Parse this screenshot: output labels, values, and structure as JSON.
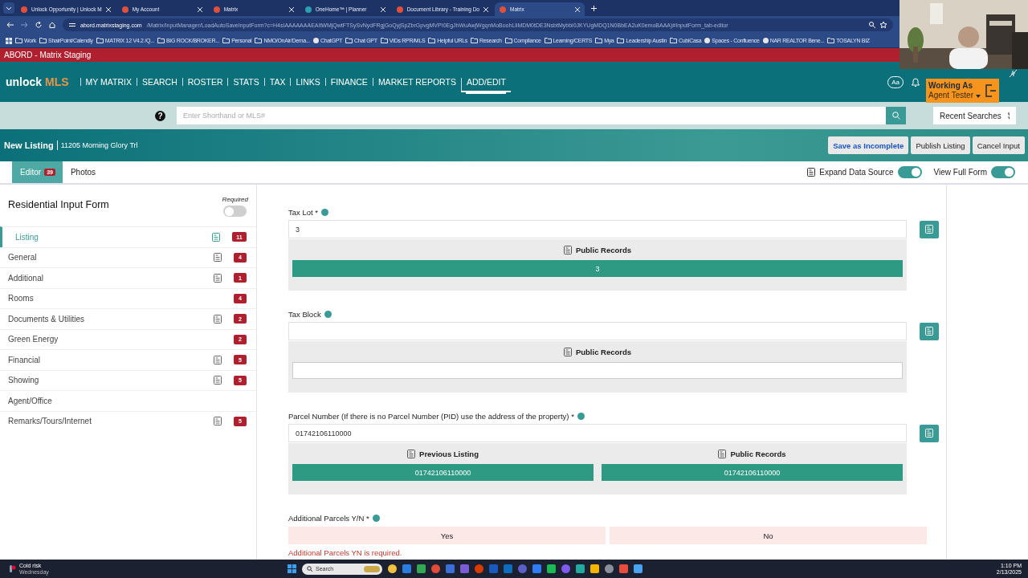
{
  "browser": {
    "tabs": [
      {
        "title": "Unlock Opportunity | Unlock M",
        "selected": false
      },
      {
        "title": "My Account",
        "selected": false
      },
      {
        "title": "Matrix",
        "selected": false
      },
      {
        "title": "OneHome™ | Planner",
        "selected": false
      },
      {
        "title": "Document Library - Training Do",
        "selected": false
      },
      {
        "title": "Matrix",
        "selected": true
      }
    ],
    "url": {
      "host": "abord.matrixstaging.com",
      "path": "/Matrix/InputManager/LoadAutoSaveInputForm?c=H4sIAAAAAAAEAItWMjQwtFTSySvNydFRgjGoQyjSpZbrGpvgMVPI0EgJhWuAwjWgqnMoBoohLliMDM0tDE3NsbtMybbi0JKYUgMDQ1N0BbEA2uK0emoBAAA)#InputForm_tab-editor"
    },
    "bookmarks": [
      {
        "label": "Work",
        "kind": "folder"
      },
      {
        "label": "ShairPoint/Calendly",
        "kind": "folder"
      },
      {
        "label": "MATRIX 12 V4.2 /Q...",
        "kind": "folder"
      },
      {
        "label": "BIG ROCK/BROKER...",
        "kind": "folder"
      },
      {
        "label": "Personal",
        "kind": "folder"
      },
      {
        "label": "NMO/OnAir/Dema...",
        "kind": "folder"
      },
      {
        "label": "ChatGPT",
        "kind": "site"
      },
      {
        "label": "Chat GPT",
        "kind": "folder"
      },
      {
        "label": "VIDs RPR/MLS",
        "kind": "folder"
      },
      {
        "label": "Helpful URLs",
        "kind": "folder"
      },
      {
        "label": "Research",
        "kind": "folder"
      },
      {
        "label": "Compliance",
        "kind": "folder"
      },
      {
        "label": "Learning/CERTS",
        "kind": "folder"
      },
      {
        "label": "Mya",
        "kind": "folder"
      },
      {
        "label": "Leadership Austin",
        "kind": "folder"
      },
      {
        "label": "CubiCasa",
        "kind": "folder"
      },
      {
        "label": "Spaces - Confluence",
        "kind": "site"
      },
      {
        "label": "NAR REALTOR Bene...",
        "kind": "site"
      },
      {
        "label": "TOSALYN BIZ",
        "kind": "folder"
      }
    ]
  },
  "banner": "ABORD - Matrix Staging",
  "header": {
    "logo": {
      "word": "unlock",
      "accent": "MLS"
    },
    "nav": [
      {
        "label": "MY MATRIX",
        "selected": false
      },
      {
        "label": "SEARCH",
        "selected": false
      },
      {
        "label": "ROSTER",
        "selected": false
      },
      {
        "label": "STATS",
        "selected": false
      },
      {
        "label": "TAX",
        "selected": false
      },
      {
        "label": "LINKS",
        "selected": false
      },
      {
        "label": "FINANCE",
        "selected": false
      },
      {
        "label": "MARKET REPORTS",
        "selected": false
      },
      {
        "label": "ADD/EDIT",
        "selected": true
      }
    ],
    "text_size_button": "Aa",
    "working_as": {
      "title": "Working As",
      "user": "Agent Tester"
    }
  },
  "search": {
    "help": "?",
    "placeholder": "Enter Shorthand or MLS#",
    "recent": "Recent Searches"
  },
  "listing": {
    "title": "New Listing",
    "address": "11205 Morning Glory Trl",
    "actions": [
      {
        "label": "Save as Incomplete",
        "kind": "primary"
      },
      {
        "label": "Publish Listing",
        "kind": "default"
      },
      {
        "label": "Cancel Input",
        "kind": "default"
      }
    ]
  },
  "editor_tabs": [
    {
      "label": "Editor",
      "count": "39",
      "selected": true
    },
    {
      "label": "Photos",
      "selected": false
    }
  ],
  "toggles": [
    {
      "label": "Expand Data Source",
      "on": true,
      "icon": true
    },
    {
      "label": "View Full Form",
      "on": true
    }
  ],
  "sidebar": {
    "title": "Residential Input Form",
    "required_label": "Required",
    "required_on": false,
    "sections": [
      {
        "label": "Listing",
        "selected": true,
        "source_icon": true,
        "count": "11"
      },
      {
        "label": "General",
        "selected": false,
        "source_icon": true,
        "count": "4"
      },
      {
        "label": "Additional",
        "selected": false,
        "source_icon": true,
        "count": "1"
      },
      {
        "label": "Rooms",
        "selected": false,
        "source_icon": false,
        "count": "4"
      },
      {
        "label": "Documents & Utilities",
        "selected": false,
        "source_icon": true,
        "count": "2"
      },
      {
        "label": "Green Energy",
        "selected": false,
        "source_icon": false,
        "count": "2"
      },
      {
        "label": "Financial",
        "selected": false,
        "source_icon": true,
        "count": "5"
      },
      {
        "label": "Showing",
        "selected": false,
        "source_icon": true,
        "count": "5"
      },
      {
        "label": "Agent/Office",
        "selected": false,
        "source_icon": false
      },
      {
        "label": "Remarks/Tours/Internet",
        "selected": false,
        "source_icon": true,
        "count": "5"
      }
    ]
  },
  "fields": [
    {
      "kind": "text",
      "label": "Tax Lot *",
      "value": "3",
      "sources": [
        {
          "label": "Public Records",
          "value": "3"
        }
      ]
    },
    {
      "kind": "text",
      "label": "Tax Block",
      "sources": [
        {
          "label": "Public Records"
        }
      ]
    },
    {
      "kind": "text",
      "label": "Parcel Number (If there is no Parcel Number (PID) use the address of the property) *",
      "value": "01742106110000",
      "sources": [
        {
          "label": "Previous Listing",
          "value": "01742106110000"
        },
        {
          "label": "Public Records",
          "value": "01742106110000"
        }
      ]
    },
    {
      "kind": "yesno",
      "label": "Additional Parcels Y/N *",
      "options": [
        {
          "label": "Yes",
          "selected": false
        },
        {
          "label": "No",
          "selected": false
        }
      ],
      "error": "Additional Parcels YN is required."
    }
  ],
  "taskbar": {
    "weather": {
      "title": "Cold risk",
      "subtitle": "Wednesday"
    },
    "search": "Search",
    "time": "1:10 PM",
    "date": "2/13/2025"
  }
}
